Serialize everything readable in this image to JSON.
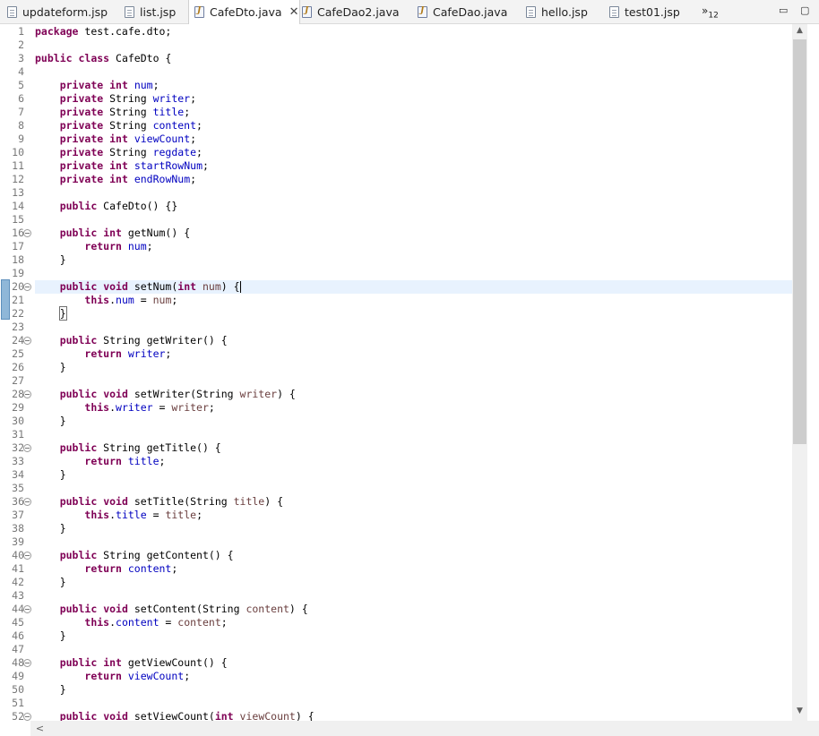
{
  "tabs": [
    {
      "label": "updateform.jsp",
      "type": "jsp"
    },
    {
      "label": "list.jsp",
      "type": "jsp"
    },
    {
      "label": "CafeDto.java",
      "type": "java",
      "active": true
    },
    {
      "label": "CafeDao2.java",
      "type": "java"
    },
    {
      "label": "CafeDao.java",
      "type": "java"
    },
    {
      "label": "hello.jsp",
      "type": "jsp"
    },
    {
      "label": "test01.jsp",
      "type": "jsp"
    }
  ],
  "overflow": {
    "chevron": "»",
    "count": "12"
  },
  "window_buttons": {
    "minimize": "▭",
    "maximize": "▢"
  },
  "editor": {
    "current_line": 20,
    "fold_lines": [
      16,
      20,
      24,
      28,
      32,
      36,
      40,
      44,
      48,
      52
    ],
    "lines": [
      "package test.cafe.dto;",
      "",
      "public class CafeDto {",
      "",
      "    private int num;",
      "    private String writer;",
      "    private String title;",
      "    private String content;",
      "    private int viewCount;",
      "    private String regdate;",
      "    private int startRowNum;",
      "    private int endRowNum;",
      "",
      "    public CafeDto() {}",
      "",
      "    public int getNum() {",
      "        return num;",
      "    }",
      "",
      "    public void setNum(int num) {",
      "        this.num = num;",
      "    }",
      "",
      "    public String getWriter() {",
      "        return writer;",
      "    }",
      "",
      "    public void setWriter(String writer) {",
      "        this.writer = writer;",
      "    }",
      "",
      "    public String getTitle() {",
      "        return title;",
      "    }",
      "",
      "    public void setTitle(String title) {",
      "        this.title = title;",
      "    }",
      "",
      "    public String getContent() {",
      "        return content;",
      "    }",
      "",
      "    public void setContent(String content) {",
      "        this.content = content;",
      "    }",
      "",
      "    public int getViewCount() {",
      "        return viewCount;",
      "    }",
      "",
      "    public void setViewCount(int viewCount) {"
    ]
  },
  "scrollbar": {
    "up_arrow": "▲",
    "down_arrow": "▼",
    "left_arrow": "<"
  }
}
